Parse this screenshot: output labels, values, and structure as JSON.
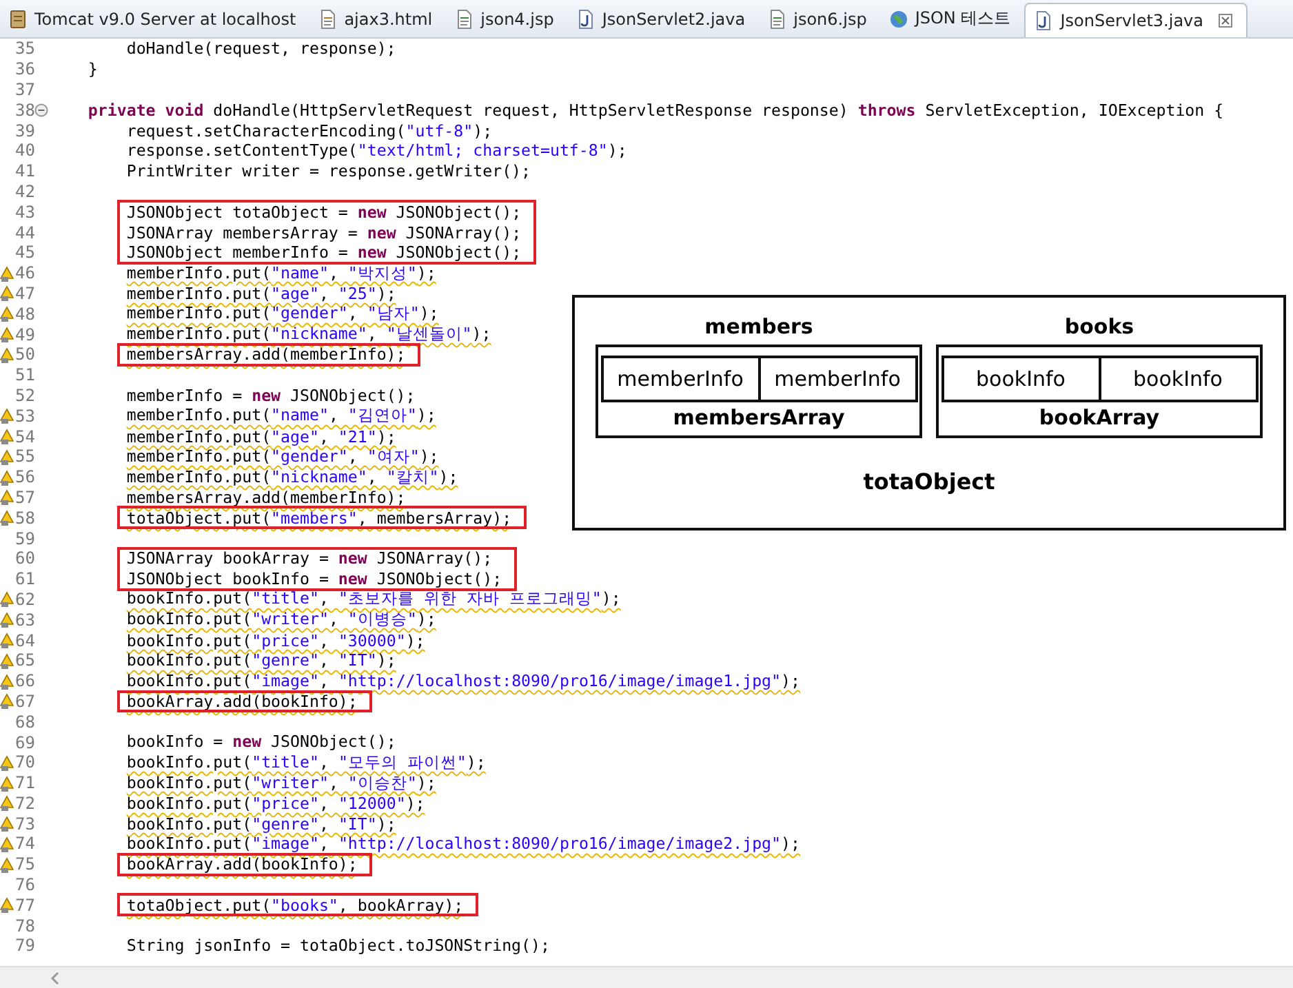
{
  "tabs": [
    {
      "label": "Tomcat v9.0 Server at localhost",
      "kind": "server",
      "selected": false
    },
    {
      "label": "ajax3.html",
      "kind": "html",
      "selected": false
    },
    {
      "label": "json4.jsp",
      "kind": "jsp",
      "selected": false
    },
    {
      "label": "JsonServlet2.java",
      "kind": "java",
      "selected": false
    },
    {
      "label": "json6.jsp",
      "kind": "jsp",
      "selected": false
    },
    {
      "label": "JSON 테스트",
      "kind": "web",
      "selected": false
    },
    {
      "label": "JsonServlet3.java",
      "kind": "java",
      "selected": true
    }
  ],
  "editor": {
    "lines": [
      {
        "number": "35",
        "warning": false,
        "boxed": false,
        "fold": false,
        "parts": [
          "        doHandle(request, response);"
        ]
      },
      {
        "number": "36",
        "warning": false,
        "boxed": false,
        "fold": false,
        "parts": [
          "    }"
        ]
      },
      {
        "number": "37",
        "warning": false,
        "boxed": false,
        "fold": false
      },
      {
        "number": "38",
        "warning": false,
        "boxed": false,
        "fold": true,
        "parts": [
          {
            "kind": "keyword",
            "text": "    private"
          },
          {
            "kind": "keyword",
            "text": " void"
          },
          " doHandle(HttpServletRequest request, HttpServletResponse response) ",
          {
            "kind": "keyword",
            "text": "throws"
          },
          " ServletException, IOException {"
        ]
      },
      {
        "number": "39",
        "warning": false,
        "boxed": false,
        "fold": false,
        "parts": [
          "        request.setCharacterEncoding(",
          {
            "kind": "string",
            "text": "\"utf-8\""
          },
          ");"
        ]
      },
      {
        "number": "40",
        "warning": false,
        "boxed": false,
        "fold": false,
        "parts": [
          "        response.setContentType(",
          {
            "kind": "string",
            "text": "\"text/html; charset=utf-8\""
          },
          ");"
        ]
      },
      {
        "number": "41",
        "warning": false,
        "boxed": false,
        "fold": false,
        "parts": [
          "        PrintWriter writer = response.getWriter();"
        ]
      },
      {
        "number": "42",
        "warning": false,
        "boxed": false,
        "fold": false
      },
      {
        "number": "43",
        "warning": false,
        "boxed": true,
        "fold": false,
        "parts": [
          "        JSONObject totaObject = ",
          {
            "kind": "keyword",
            "text": "new"
          },
          " JSONObject();"
        ]
      },
      {
        "number": "44",
        "warning": false,
        "boxed": true,
        "fold": false,
        "parts": [
          "        JSONArray membersArray = ",
          {
            "kind": "keyword",
            "text": "new"
          },
          " JSONArray();"
        ]
      },
      {
        "number": "45",
        "warning": false,
        "boxed": true,
        "fold": false,
        "parts": [
          "        JSONObject memberInfo = ",
          {
            "kind": "keyword",
            "text": "new"
          },
          " JSONObject();"
        ]
      },
      {
        "number": "46",
        "warning": true,
        "boxed": false,
        "fold": false,
        "parts": [
          "        memberInfo.put(",
          {
            "kind": "string",
            "text": "\"name\""
          },
          ", ",
          {
            "kind": "string",
            "text": "\"박지성\""
          },
          ");"
        ]
      },
      {
        "number": "47",
        "warning": true,
        "boxed": false,
        "fold": false,
        "parts": [
          "        memberInfo.put(",
          {
            "kind": "string",
            "text": "\"age\""
          },
          ", ",
          {
            "kind": "string",
            "text": "\"25\""
          },
          ");"
        ]
      },
      {
        "number": "48",
        "warning": true,
        "boxed": false,
        "fold": false,
        "parts": [
          "        memberInfo.put(",
          {
            "kind": "string",
            "text": "\"gender\""
          },
          ", ",
          {
            "kind": "string",
            "text": "\"남자\""
          },
          ");"
        ]
      },
      {
        "number": "49",
        "warning": true,
        "boxed": false,
        "fold": false,
        "parts": [
          "        memberInfo.put(",
          {
            "kind": "string",
            "text": "\"nickname\""
          },
          ", ",
          {
            "kind": "string",
            "text": "\"날센돌이\""
          },
          ");"
        ]
      },
      {
        "number": "50",
        "warning": true,
        "boxed": true,
        "fold": false,
        "parts": [
          "        membersArray.add(memberInfo);"
        ]
      },
      {
        "number": "51",
        "warning": false,
        "boxed": false,
        "fold": false
      },
      {
        "number": "52",
        "warning": false,
        "boxed": false,
        "fold": false,
        "parts": [
          "        memberInfo = ",
          {
            "kind": "keyword",
            "text": "new"
          },
          " JSONObject();"
        ]
      },
      {
        "number": "53",
        "warning": true,
        "boxed": false,
        "fold": false,
        "parts": [
          "        memberInfo.put(",
          {
            "kind": "string",
            "text": "\"name\""
          },
          ", ",
          {
            "kind": "string",
            "text": "\"김연아\""
          },
          ");"
        ]
      },
      {
        "number": "54",
        "warning": true,
        "boxed": false,
        "fold": false,
        "parts": [
          "        memberInfo.put(",
          {
            "kind": "string",
            "text": "\"age\""
          },
          ", ",
          {
            "kind": "string",
            "text": "\"21\""
          },
          ");"
        ]
      },
      {
        "number": "55",
        "warning": true,
        "boxed": false,
        "fold": false,
        "parts": [
          "        memberInfo.put(",
          {
            "kind": "string",
            "text": "\"gender\""
          },
          ", ",
          {
            "kind": "string",
            "text": "\"여자\""
          },
          ");"
        ]
      },
      {
        "number": "56",
        "warning": true,
        "boxed": false,
        "fold": false,
        "parts": [
          "        memberInfo.put(",
          {
            "kind": "string",
            "text": "\"nickname\""
          },
          ", ",
          {
            "kind": "string",
            "text": "\"칼치\""
          },
          ");"
        ]
      },
      {
        "number": "57",
        "warning": true,
        "boxed": false,
        "fold": false,
        "parts": [
          "        membersArray.add(memberInfo);"
        ]
      },
      {
        "number": "58",
        "warning": true,
        "boxed": true,
        "fold": false,
        "parts": [
          "        totaObject.put(",
          {
            "kind": "string",
            "text": "\"members\""
          },
          ", membersArray);"
        ]
      },
      {
        "number": "59",
        "warning": false,
        "boxed": false,
        "fold": false
      },
      {
        "number": "60",
        "warning": false,
        "boxed": true,
        "fold": false,
        "parts": [
          "        JSONArray bookArray = ",
          {
            "kind": "keyword",
            "text": "new"
          },
          " JSONArray();"
        ]
      },
      {
        "number": "61",
        "warning": false,
        "boxed": true,
        "fold": false,
        "parts": [
          "        JSONObject bookInfo = ",
          {
            "kind": "keyword",
            "text": "new"
          },
          " JSONObject();"
        ]
      },
      {
        "number": "62",
        "warning": true,
        "boxed": false,
        "fold": false,
        "parts": [
          "        bookInfo.put(",
          {
            "kind": "string",
            "text": "\"title\""
          },
          ", ",
          {
            "kind": "string",
            "text": "\"초보자를 위한 자바 프로그래밍\""
          },
          ");"
        ]
      },
      {
        "number": "63",
        "warning": true,
        "boxed": false,
        "fold": false,
        "parts": [
          "        bookInfo.put(",
          {
            "kind": "string",
            "text": "\"writer\""
          },
          ", ",
          {
            "kind": "string",
            "text": "\"이병승\""
          },
          ");"
        ]
      },
      {
        "number": "64",
        "warning": true,
        "boxed": false,
        "fold": false,
        "parts": [
          "        bookInfo.put(",
          {
            "kind": "string",
            "text": "\"price\""
          },
          ", ",
          {
            "kind": "string",
            "text": "\"30000\""
          },
          ");"
        ]
      },
      {
        "number": "65",
        "warning": true,
        "boxed": false,
        "fold": false,
        "parts": [
          "        bookInfo.put(",
          {
            "kind": "string",
            "text": "\"genre\""
          },
          ", ",
          {
            "kind": "string",
            "text": "\"IT\""
          },
          ");"
        ]
      },
      {
        "number": "66",
        "warning": true,
        "boxed": false,
        "fold": false,
        "parts": [
          "        bookInfo.put(",
          {
            "kind": "string",
            "text": "\"image\""
          },
          ", ",
          {
            "kind": "string",
            "text": "\"http://localhost:8090/pro16/image/image1.jpg\""
          },
          ");"
        ]
      },
      {
        "number": "67",
        "warning": true,
        "boxed": true,
        "fold": false,
        "parts": [
          "        bookArray.add(bookInfo);"
        ]
      },
      {
        "number": "68",
        "warning": false,
        "boxed": false,
        "fold": false
      },
      {
        "number": "69",
        "warning": false,
        "boxed": false,
        "fold": false,
        "parts": [
          "        bookInfo = ",
          {
            "kind": "keyword",
            "text": "new"
          },
          " JSONObject();"
        ]
      },
      {
        "number": "70",
        "warning": true,
        "boxed": false,
        "fold": false,
        "parts": [
          "        bookInfo.put(",
          {
            "kind": "string",
            "text": "\"title\""
          },
          ", ",
          {
            "kind": "string",
            "text": "\"모두의 파이썬\""
          },
          ");"
        ]
      },
      {
        "number": "71",
        "warning": true,
        "boxed": false,
        "fold": false,
        "parts": [
          "        bookInfo.put(",
          {
            "kind": "string",
            "text": "\"writer\""
          },
          ", ",
          {
            "kind": "string",
            "text": "\"이승찬\""
          },
          ");"
        ]
      },
      {
        "number": "72",
        "warning": true,
        "boxed": false,
        "fold": false,
        "parts": [
          "        bookInfo.put(",
          {
            "kind": "string",
            "text": "\"price\""
          },
          ", ",
          {
            "kind": "string",
            "text": "\"12000\""
          },
          ");"
        ]
      },
      {
        "number": "73",
        "warning": true,
        "boxed": false,
        "fold": false,
        "parts": [
          "        bookInfo.put(",
          {
            "kind": "string",
            "text": "\"genre\""
          },
          ", ",
          {
            "kind": "string",
            "text": "\"IT\""
          },
          ");"
        ]
      },
      {
        "number": "74",
        "warning": true,
        "boxed": false,
        "fold": false,
        "parts": [
          "        bookInfo.put(",
          {
            "kind": "string",
            "text": "\"image\""
          },
          ", ",
          {
            "kind": "string",
            "text": "\"http://localhost:8090/pro16/image/image2.jpg\""
          },
          ");"
        ]
      },
      {
        "number": "75",
        "warning": true,
        "boxed": true,
        "fold": false,
        "parts": [
          "        bookArray.add(bookInfo);"
        ]
      },
      {
        "number": "76",
        "warning": false,
        "boxed": false,
        "fold": false
      },
      {
        "number": "77",
        "warning": true,
        "boxed": true,
        "fold": false,
        "parts": [
          "        totaObject.put(",
          {
            "kind": "string",
            "text": "\"books\""
          },
          ", bookArray);"
        ]
      },
      {
        "number": "78",
        "warning": false,
        "boxed": false,
        "fold": false
      },
      {
        "number": "79",
        "warning": false,
        "boxed": false,
        "fold": false,
        "parts": [
          "        String jsonInfo = totaObject.toJSONString();"
        ]
      }
    ]
  },
  "diagram": {
    "outer_label": "totaObject",
    "groups": [
      {
        "title": "members",
        "array_label": "membersArray",
        "items": [
          "memberInfo",
          "memberInfo"
        ]
      },
      {
        "title": "books",
        "array_label": "bookArray",
        "items": [
          "bookInfo",
          "bookInfo"
        ]
      }
    ]
  }
}
